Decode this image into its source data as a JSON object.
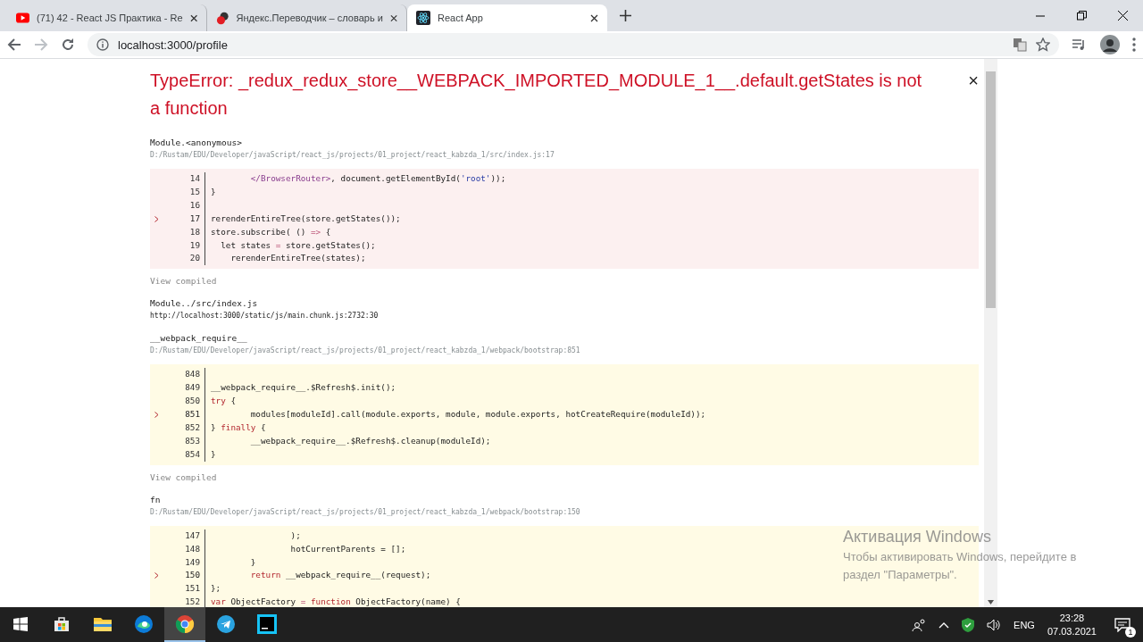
{
  "browser": {
    "tabs": [
      {
        "title": "(71) 42 - React JS Практика - Re",
        "kind": "video",
        "selected": false
      },
      {
        "title": "Яндекс.Переводчик – словарь и",
        "kind": "translate",
        "selected": false
      },
      {
        "title": "React App",
        "kind": "react",
        "selected": true
      }
    ],
    "address": "localhost:3000/profile"
  },
  "error": {
    "title": "TypeError: _redux_redux_store__WEBPACK_IMPORTED_MODULE_1__.default.getStates is not a function",
    "close": "×",
    "frames": [
      {
        "name": "Module.<anonymous>",
        "location": "D:/Rustam/EDU/Developer/javaScript/react_js/projects/01_project/react_kabzda_1/src/index.js:17",
        "kind": "app",
        "link": "View compiled",
        "lines": [
          {
            "number": "14",
            "pointer": false,
            "parts": [
              {
                "text": "        </BrowserRouter>",
                "kind": "tag"
              },
              {
                "text": ", document.getElementById(",
                "kind": "plain"
              },
              {
                "text": "'root'",
                "kind": "string"
              },
              {
                "text": "));",
                "kind": "plain"
              }
            ]
          },
          {
            "number": "15",
            "pointer": false,
            "parts": [
              {
                "text": "}",
                "kind": "plain"
              }
            ]
          },
          {
            "number": "16",
            "pointer": false
          },
          {
            "number": "17",
            "pointer": true,
            "parts": [
              {
                "text": "rerenderEntireTree(store.getStates());",
                "kind": "plain"
              }
            ]
          },
          {
            "number": "18",
            "pointer": false,
            "parts": [
              {
                "text": "store.subscribe( () ",
                "kind": "plain"
              },
              {
                "text": "=>",
                "kind": "operator"
              },
              {
                "text": " {",
                "kind": "plain"
              }
            ]
          },
          {
            "number": "19",
            "pointer": false,
            "parts": [
              {
                "text": "  let states ",
                "kind": "plain"
              },
              {
                "text": "=",
                "kind": "operator"
              },
              {
                "text": " store.getStates();",
                "kind": "plain"
              }
            ]
          },
          {
            "number": "20",
            "pointer": false,
            "parts": [
              {
                "text": "    rerenderEntireTree(states);",
                "kind": "plain"
              }
            ]
          }
        ]
      },
      {
        "name": "Module../src/index.js",
        "location": "http://localhost:3000/static/js/main.chunk.js:2732:30",
        "kind": "compiled"
      },
      {
        "name": "__webpack_require__",
        "location": "D:/Rustam/EDU/Developer/javaScript/react_js/projects/01_project/react_kabzda_1/webpack/bootstrap:851",
        "kind": "library",
        "link": "View compiled",
        "lines": [
          {
            "number": "848",
            "pointer": false
          },
          {
            "number": "849",
            "pointer": false,
            "parts": [
              {
                "text": "__webpack_require__.$Refresh$.init();",
                "kind": "plain"
              }
            ]
          },
          {
            "number": "850",
            "pointer": false,
            "parts": [
              {
                "text": "try",
                "kind": "keyword"
              },
              {
                "text": " {",
                "kind": "plain"
              }
            ]
          },
          {
            "number": "851",
            "pointer": true,
            "parts": [
              {
                "text": "        modules[moduleId].call(module.exports, module, module.exports, hotCreateRequire(moduleId));",
                "kind": "plain"
              }
            ]
          },
          {
            "number": "852",
            "pointer": false,
            "parts": [
              {
                "text": "} ",
                "kind": "plain"
              },
              {
                "text": "finally",
                "kind": "keyword"
              },
              {
                "text": " {",
                "kind": "plain"
              }
            ]
          },
          {
            "number": "853",
            "pointer": false,
            "parts": [
              {
                "text": "        __webpack_require__.$Refresh$.cleanup(moduleId);",
                "kind": "plain"
              }
            ]
          },
          {
            "number": "854",
            "pointer": false,
            "parts": [
              {
                "text": "}",
                "kind": "plain"
              }
            ]
          }
        ]
      },
      {
        "name": "fn",
        "location": "D:/Rustam/EDU/Developer/javaScript/react_js/projects/01_project/react_kabzda_1/webpack/bootstrap:150",
        "kind": "library",
        "lines": [
          {
            "number": "147",
            "pointer": false,
            "parts": [
              {
                "text": "                );",
                "kind": "plain"
              }
            ]
          },
          {
            "number": "148",
            "pointer": false,
            "parts": [
              {
                "text": "                hotCurrentParents = [];",
                "kind": "plain"
              }
            ]
          },
          {
            "number": "149",
            "pointer": false,
            "parts": [
              {
                "text": "        }",
                "kind": "plain"
              }
            ]
          },
          {
            "number": "150",
            "pointer": true,
            "parts": [
              {
                "text": "        return",
                "kind": "keyword"
              },
              {
                "text": " __webpack_require__(request);",
                "kind": "plain"
              }
            ]
          },
          {
            "number": "151",
            "pointer": false,
            "parts": [
              {
                "text": "};",
                "kind": "plain"
              }
            ]
          },
          {
            "number": "152",
            "pointer": false,
            "parts": [
              {
                "text": "var",
                "kind": "keyword"
              },
              {
                "text": " ObjectFactory ",
                "kind": "plain"
              },
              {
                "text": "=",
                "kind": "operator"
              },
              {
                "text": " function",
                "kind": "keyword"
              },
              {
                "text": " ObjectFactory(name) {",
                "kind": "plain"
              }
            ]
          }
        ]
      }
    ]
  },
  "activation": {
    "title": "Активация Windows",
    "text": "Чтобы активировать Windows, перейдите в раздел \"Параметры\"."
  },
  "taskbar": {
    "apps": [
      {
        "kind": "store",
        "active": false
      },
      {
        "kind": "folder",
        "active": false
      },
      {
        "kind": "edge",
        "active": false
      },
      {
        "kind": "chrome",
        "active": true
      },
      {
        "kind": "telegram",
        "active": false
      },
      {
        "kind": "webstorm",
        "active": false
      }
    ],
    "language": "ENG",
    "time": "23:28",
    "date": "07.03.2021",
    "notifications": "1"
  }
}
